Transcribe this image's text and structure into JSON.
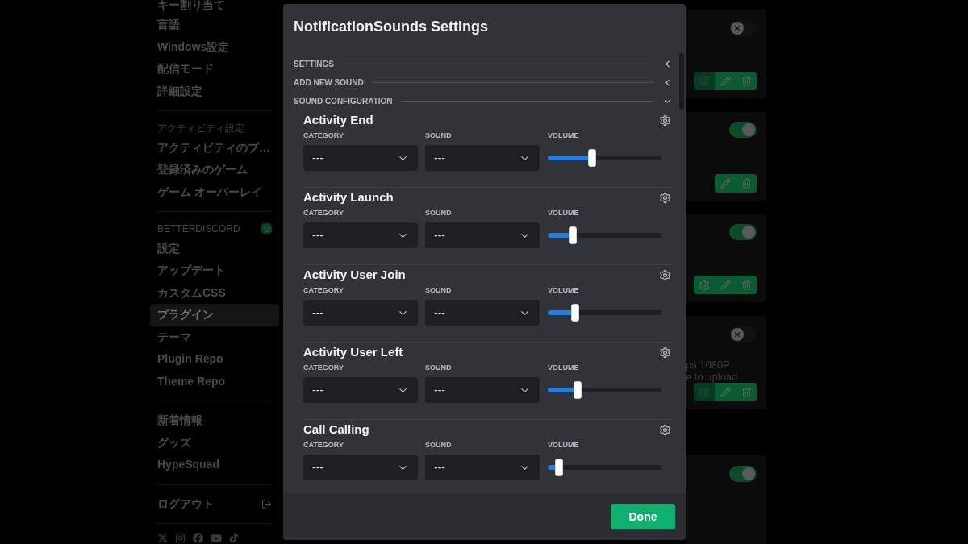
{
  "sidebar": {
    "items": [
      {
        "kind": "item",
        "label": "キー割り当て",
        "selected": false
      },
      {
        "kind": "item",
        "label": "言語",
        "selected": false
      },
      {
        "kind": "item",
        "label": "Windows設定",
        "selected": false
      },
      {
        "kind": "item",
        "label": "配信モード",
        "selected": false
      },
      {
        "kind": "item",
        "label": "詳細設定",
        "selected": false
      },
      {
        "kind": "divider"
      },
      {
        "kind": "header",
        "label": "アクティビティ設定"
      },
      {
        "kind": "item",
        "label": "アクティビティのプ…",
        "selected": false
      },
      {
        "kind": "item",
        "label": "登録済みのゲーム",
        "selected": false
      },
      {
        "kind": "item",
        "label": "ゲーム オーバーレイ",
        "selected": false
      },
      {
        "kind": "divider"
      },
      {
        "kind": "header",
        "label": "BETTERDISCORD",
        "badge": true
      },
      {
        "kind": "item",
        "label": "設定",
        "selected": false
      },
      {
        "kind": "item",
        "label": "アップデート",
        "selected": false
      },
      {
        "kind": "item",
        "label": "カスタムCSS",
        "selected": false
      },
      {
        "kind": "item",
        "label": "プラグイン",
        "selected": true
      },
      {
        "kind": "item",
        "label": "テーマ",
        "selected": false
      },
      {
        "kind": "item",
        "label": "Plugin Repo",
        "selected": false
      },
      {
        "kind": "item",
        "label": "Theme Repo",
        "selected": false
      },
      {
        "kind": "divider"
      },
      {
        "kind": "item",
        "label": "新着情報",
        "selected": false
      },
      {
        "kind": "item",
        "label": "グッズ",
        "selected": false
      },
      {
        "kind": "item",
        "label": "HypeSquad",
        "selected": false
      },
      {
        "kind": "divider"
      },
      {
        "kind": "logout",
        "label": "ログアウト"
      },
      {
        "kind": "divider"
      },
      {
        "kind": "social"
      }
    ]
  },
  "plugin_cards": [
    {
      "on": false,
      "actions": [
        {
          "kind": "settings",
          "disabled": true
        },
        {
          "kind": "edit"
        },
        {
          "kind": "delete"
        }
      ]
    },
    {
      "on": true,
      "actions": [
        {
          "kind": "edit"
        },
        {
          "kind": "delete"
        }
      ]
    },
    {
      "on": true,
      "actions": [
        {
          "kind": "settings",
          "disabled": false
        },
        {
          "kind": "edit"
        },
        {
          "kind": "delete"
        }
      ]
    },
    {
      "on": false,
      "lines": [
        "ps 1080P",
        "e to upload"
      ],
      "actions": [
        {
          "kind": "settings",
          "disabled": true
        },
        {
          "kind": "edit"
        },
        {
          "kind": "delete"
        }
      ]
    },
    {
      "on": true
    }
  ],
  "modal": {
    "title": "NotificationSounds Settings",
    "sections": [
      {
        "label": "SETTINGS",
        "expanded": false
      },
      {
        "label": "ADD NEW SOUND",
        "expanded": false
      },
      {
        "label": "SOUND CONFIGURATION",
        "expanded": true
      }
    ],
    "sounds": [
      {
        "name": "Activity End",
        "category_label": "CATEGORY",
        "category": "---",
        "sound_label": "SOUND",
        "sound": "---",
        "volume_label": "VOLUME",
        "level": 0.39
      },
      {
        "name": "Activity Launch",
        "category_label": "CATEGORY",
        "category": "---",
        "sound_label": "SOUND",
        "sound": "---",
        "volume_label": "VOLUME",
        "level": 0.22
      },
      {
        "name": "Activity User Join",
        "category_label": "CATEGORY",
        "category": "---",
        "sound_label": "SOUND",
        "sound": "---",
        "volume_label": "VOLUME",
        "level": 0.24
      },
      {
        "name": "Activity User Left",
        "category_label": "CATEGORY",
        "category": "---",
        "sound_label": "SOUND",
        "sound": "---",
        "volume_label": "VOLUME",
        "level": 0.26
      },
      {
        "name": "Call Calling",
        "category_label": "CATEGORY",
        "category": "---",
        "sound_label": "SOUND",
        "sound": "---",
        "volume_label": "VOLUME",
        "level": 0.1
      }
    ],
    "done_button": "Done"
  }
}
